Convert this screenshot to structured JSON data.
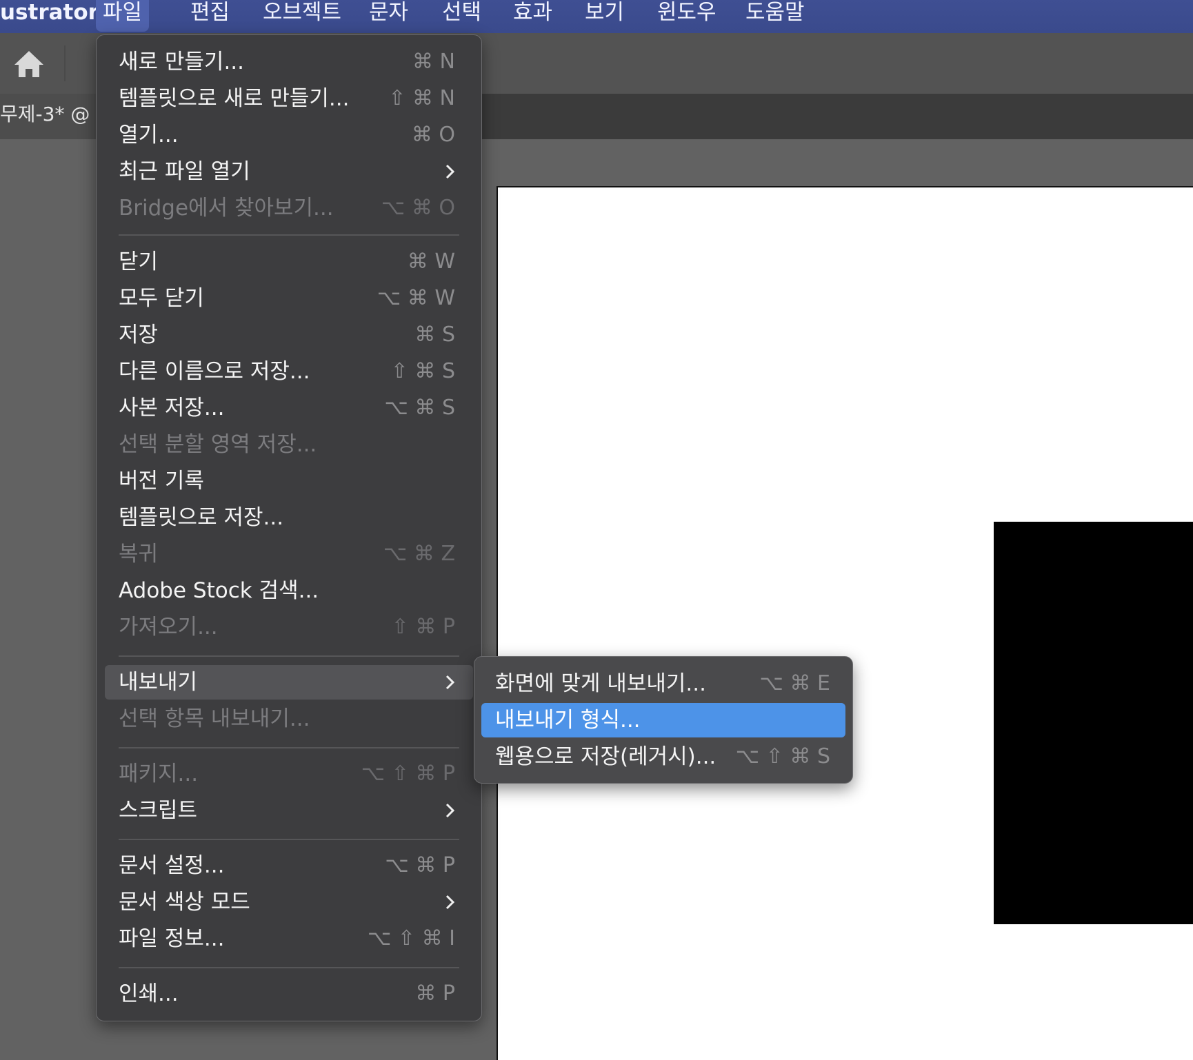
{
  "menubar": {
    "app_name": "ustrator",
    "menus": [
      "파일",
      "편집",
      "오브젝트",
      "문자",
      "선택",
      "효과",
      "보기",
      "윈도우",
      "도움말"
    ],
    "active_menu": "파일"
  },
  "document_tab": {
    "title": "무제-3* @"
  },
  "file_menu": {
    "items": [
      {
        "label": "새로 만들기...",
        "shortcut": "⌘ N",
        "disabled": false
      },
      {
        "label": "템플릿으로 새로 만들기...",
        "shortcut": "⇧ ⌘ N",
        "disabled": false
      },
      {
        "label": "열기...",
        "shortcut": "⌘ O",
        "disabled": false
      },
      {
        "label": "최근 파일 열기",
        "shortcut": "",
        "submenu": true,
        "disabled": false
      },
      {
        "label": "Bridge에서 찾아보기...",
        "shortcut": "⌥ ⌘ O",
        "disabled": true
      },
      {
        "label": "닫기",
        "shortcut": "⌘ W",
        "disabled": false
      },
      {
        "label": "모두 닫기",
        "shortcut": "⌥ ⌘ W",
        "disabled": false
      },
      {
        "label": "저장",
        "shortcut": "⌘ S",
        "disabled": false
      },
      {
        "label": "다른 이름으로 저장...",
        "shortcut": "⇧ ⌘ S",
        "disabled": false
      },
      {
        "label": "사본 저장...",
        "shortcut": "⌥ ⌘ S",
        "disabled": false
      },
      {
        "label": "선택 분할 영역 저장...",
        "shortcut": "",
        "disabled": true
      },
      {
        "label": "버전 기록",
        "shortcut": "",
        "disabled": false
      },
      {
        "label": "템플릿으로 저장...",
        "shortcut": "",
        "disabled": false
      },
      {
        "label": "복귀",
        "shortcut": "⌥ ⌘ Z",
        "disabled": true
      },
      {
        "label": "Adobe Stock 검색...",
        "shortcut": "",
        "disabled": false
      },
      {
        "label": "가져오기...",
        "shortcut": "⇧ ⌘ P",
        "disabled": true
      },
      {
        "label": "내보내기",
        "shortcut": "",
        "submenu": true,
        "disabled": false,
        "hover": true
      },
      {
        "label": "선택 항목 내보내기...",
        "shortcut": "",
        "disabled": true
      },
      {
        "label": "패키지...",
        "shortcut": "⌥ ⇧ ⌘ P",
        "disabled": true
      },
      {
        "label": "스크립트",
        "shortcut": "",
        "submenu": true,
        "disabled": false
      },
      {
        "label": "문서 설정...",
        "shortcut": "⌥ ⌘ P",
        "disabled": false
      },
      {
        "label": "문서 색상 모드",
        "shortcut": "",
        "submenu": true,
        "disabled": false
      },
      {
        "label": "파일 정보...",
        "shortcut": "⌥ ⇧ ⌘ I",
        "disabled": false
      },
      {
        "label": "인쇄...",
        "shortcut": "⌘ P",
        "disabled": false
      }
    ]
  },
  "export_submenu": {
    "items": [
      {
        "label": "화면에 맞게 내보내기...",
        "shortcut": "⌥ ⌘ E",
        "selected": false
      },
      {
        "label": "내보내기 형식...",
        "shortcut": "",
        "selected": true
      },
      {
        "label": "웹용으로 저장(레거시)...",
        "shortcut": "⌥ ⇧ ⌘ S",
        "selected": false
      }
    ]
  },
  "colors": {
    "menubar": "#3a4a8c",
    "menu_background": "#3d3d3f",
    "selection": "#4d93e8",
    "artboard": "#ffffff",
    "shape": "#000000"
  }
}
